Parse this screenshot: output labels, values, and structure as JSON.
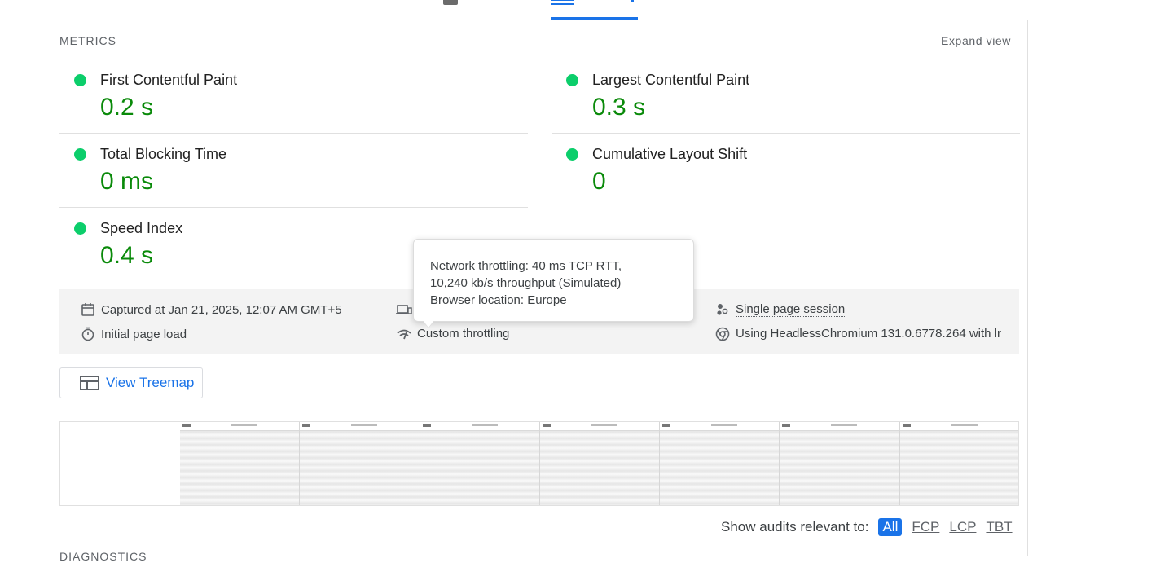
{
  "metrics": {
    "header": "METRICS",
    "expand_label": "Expand view",
    "items": [
      {
        "name": "First Contentful Paint",
        "value": "0.2 s",
        "status": "good"
      },
      {
        "name": "Largest Contentful Paint",
        "value": "0.3 s",
        "status": "good"
      },
      {
        "name": "Total Blocking Time",
        "value": "0 ms",
        "status": "good"
      },
      {
        "name": "Cumulative Layout Shift",
        "value": "0",
        "status": "good"
      },
      {
        "name": "Speed Index",
        "value": "0.4 s",
        "status": "good"
      }
    ]
  },
  "info": {
    "captured": "Captured at Jan 21, 2025, 12:07 AM GMT+5",
    "initial_load": "Initial page load",
    "throttling": "Custom throttling",
    "session": "Single page session",
    "browser": "Using HeadlessChromium 131.0.6778.264 with lr"
  },
  "tooltip": {
    "line1": "Network throttling: 40 ms TCP RTT,",
    "line2": "10,240 kb/s throughput (Simulated)",
    "line3": "Browser location: Europe"
  },
  "treemap": {
    "label": "View Treemap"
  },
  "audits_filter": {
    "label": "Show audits relevant to:",
    "options": [
      "All",
      "FCP",
      "LCP",
      "TBT"
    ],
    "selected": "All"
  },
  "diagnostics": {
    "header": "DIAGNOSTICS"
  },
  "colors": {
    "good": "#0cce6b",
    "value": "#0a8a0a",
    "accent": "#1a73e8"
  }
}
